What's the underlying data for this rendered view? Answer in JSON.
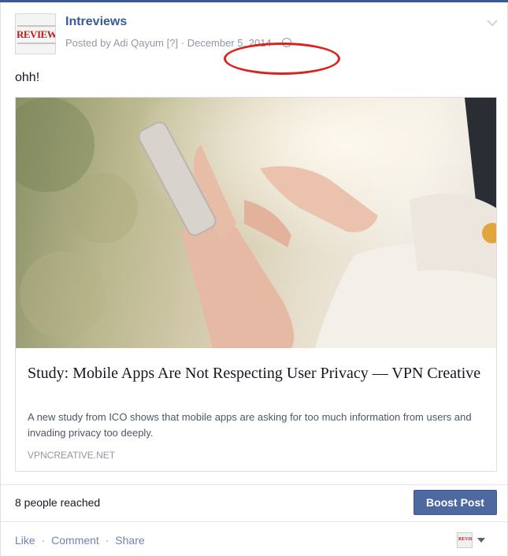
{
  "post": {
    "page_name": "Intreviews",
    "posted_by": "Posted by Adi Qayum",
    "help_marker": "[?]",
    "separator": "·",
    "date": "December 5, 2014",
    "avatar_text": "REVIEWS",
    "status_text": "ohh!"
  },
  "link_preview": {
    "title": "Study: Mobile Apps Are Not Respecting User Privacy — VPN Creative",
    "description": "A new study from ICO shows that mobile apps are asking for too much information from users and invading privacy too deeply.",
    "domain": "VPNCREATIVE.NET"
  },
  "insights": {
    "reach": "8 people reached",
    "boost_label": "Boost Post"
  },
  "actions": {
    "like": "Like",
    "comment": "Comment",
    "share": "Share",
    "dot": "·"
  },
  "icons": {
    "menu": "chevron-down-icon",
    "audience": "globe-icon",
    "selector": "caret-down-icon"
  },
  "colors": {
    "brand": "#3b5998",
    "boost": "#4e69a2",
    "highlight": "#d9231e",
    "link": "#6d84b4"
  }
}
